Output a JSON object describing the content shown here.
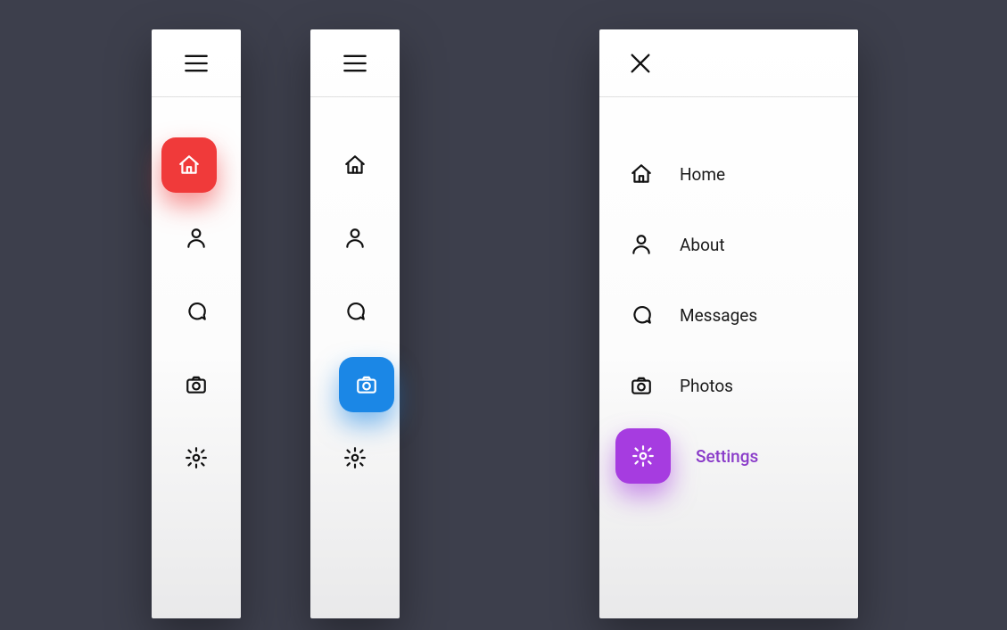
{
  "toggle": {
    "hamburger": "menu",
    "close": "close"
  },
  "nav": {
    "items": [
      {
        "icon": "home",
        "label": "Home"
      },
      {
        "icon": "user",
        "label": "About"
      },
      {
        "icon": "chat",
        "label": "Messages"
      },
      {
        "icon": "camera",
        "label": "Photos"
      },
      {
        "icon": "settings",
        "label": "Settings"
      }
    ],
    "active_index_panel1": 0,
    "active_index_panel2": 3,
    "active_index_panel3": 4
  },
  "colors": {
    "panel1_active": "#f03a3a",
    "panel2_active": "#1b87e6",
    "panel3_active": "#a63ce0",
    "background": "#3d3f4c"
  }
}
